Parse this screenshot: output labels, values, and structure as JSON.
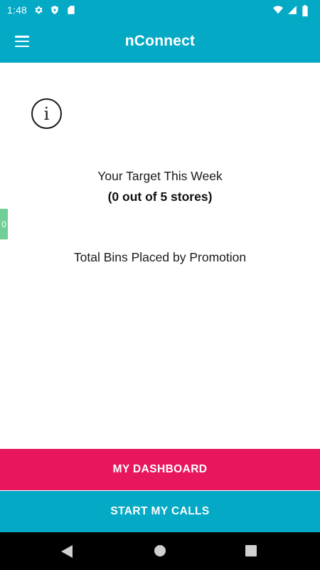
{
  "status_bar": {
    "time": "1:48",
    "icons_left": [
      "settings-icon",
      "play-protect-icon",
      "sd-card-icon"
    ],
    "icons_right": [
      "wifi-icon",
      "signal-icon",
      "battery-icon"
    ]
  },
  "app_bar": {
    "title": "nConnect",
    "menu_icon": "hamburger-menu-icon"
  },
  "main": {
    "info_icon_glyph": "i",
    "target_label": "Your Target This Week",
    "target_value": "(0 out of 5 stores)",
    "side_tab_value": "0",
    "bins_label": "Total Bins Placed by Promotion"
  },
  "buttons": {
    "dashboard": "MY DASHBOARD",
    "start_calls": "START MY CALLS"
  },
  "colors": {
    "primary": "#04a9c6",
    "accent": "#e8175d",
    "side_tab": "#6fcf97"
  }
}
